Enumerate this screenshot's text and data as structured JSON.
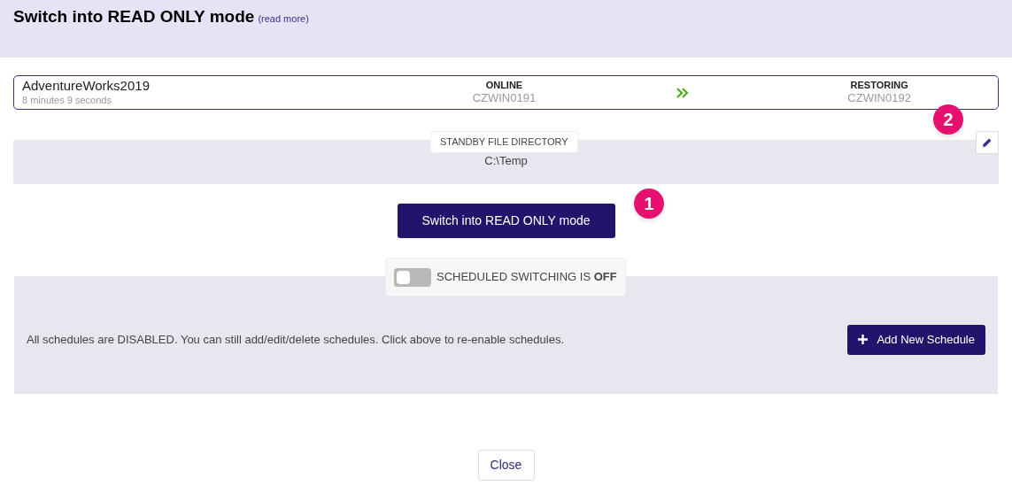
{
  "header": {
    "title": "Switch into READ ONLY mode",
    "link": "(read more)"
  },
  "database": {
    "name": "AdventureWorks2019",
    "elapsed": "8 minutes 9 seconds",
    "source": {
      "state": "ONLINE",
      "server": "CZWIN0191"
    },
    "target": {
      "state": "RESTORING",
      "server": "CZWIN0192"
    }
  },
  "standby": {
    "label": "STANDBY FILE DIRECTORY",
    "path": "C:\\Temp"
  },
  "switch_button": "Switch into READ ONLY mode",
  "callouts": [
    "1",
    "2"
  ],
  "scheduling": {
    "on": false,
    "label": "SCHEDULED SWITCHING IS **OFF**",
    "message": "All schedules are DISABLED. You can still add/edit/delete schedules. Click above to re-enable schedules.",
    "add_button": "Add New Schedule"
  },
  "close_button": "Close"
}
